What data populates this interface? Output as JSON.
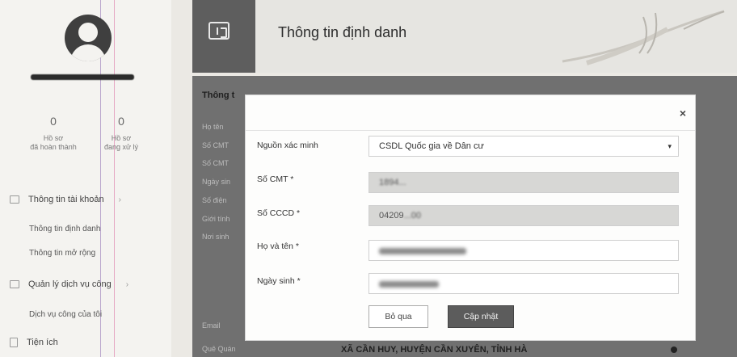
{
  "sidebar": {
    "stats": [
      {
        "count": "0",
        "label_line1": "Hồ sơ",
        "label_line2": "đã hoàn thành"
      },
      {
        "count": "0",
        "label_line1": "Hồ sơ",
        "label_line2": "đang xử lý"
      }
    ],
    "menu": {
      "account": "Thông tin tài khoản",
      "account_sub": [
        "Thông tin định danh",
        "Thông tin mở rộng"
      ],
      "public_services": "Quản lý dịch vụ công",
      "public_services_sub": [
        "Dịch vụ công của tôi"
      ],
      "utilities": "Tiện ích"
    },
    "chevron": "›"
  },
  "header": {
    "title": "Thông tin định danh",
    "icon": "folder-id-icon"
  },
  "background_panel": {
    "title": "Thông t",
    "fields": [
      "Họ tên",
      "Số CMT",
      "Số CMT",
      "Ngày sin",
      "Số điện",
      "Giới tính",
      "Nơi sinh",
      "Email",
      "Quê Quán"
    ],
    "hometown_value": "XÃ CẦN HUY, HUYỆN CẦN XUYÊN, TỈNH HÀ"
  },
  "modal": {
    "close": "×",
    "labels": {
      "source": "Nguồn xác minh",
      "cmt": "Số CMT *",
      "cccd": "Số CCCD *",
      "name": "Họ và tên *",
      "dob": "Ngày sinh *"
    },
    "values": {
      "source": "CSDL Quốc gia về Dân cư",
      "cmt": "1894...",
      "cccd_visible": "04209",
      "cccd_hidden": "...00"
    },
    "buttons": {
      "skip": "Bỏ qua",
      "update": "Cập nhật"
    },
    "select_caret": "▾"
  },
  "colors": {
    "overlay": "#707070",
    "update_button": "#5c5c5c",
    "readonly_field": "#d7d7d5"
  }
}
